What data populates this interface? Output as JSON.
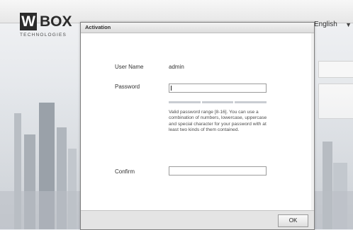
{
  "brand": {
    "letter": "W",
    "word": "BOX",
    "tagline": "TECHNOLOGIES"
  },
  "language": {
    "selected": "English",
    "chevron_icon": "chevron-down-icon"
  },
  "dialog": {
    "title": "Activation",
    "user_name_label": "User Name",
    "user_name_value": "admin",
    "password_label": "Password",
    "password_value": "",
    "password_hint": "Valid password range [8-16]. You can use a combination of numbers, lowercase, uppercase and special character for your password with at least two kinds of them contained.",
    "confirm_label": "Confirm",
    "confirm_value": "",
    "ok_label": "OK"
  }
}
